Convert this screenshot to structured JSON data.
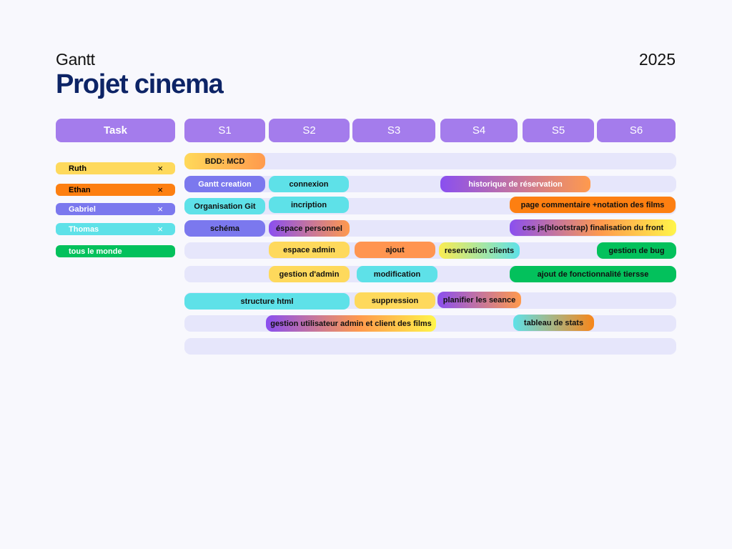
{
  "header": {
    "subtitle": "Gantt",
    "title": "Projet cinema",
    "year": "2025"
  },
  "columns": {
    "task": "Task",
    "weeks": [
      "S1",
      "S2",
      "S3",
      "S4",
      "S5",
      "S6"
    ]
  },
  "legend": [
    {
      "name": "Ruth",
      "close": "×",
      "color": "#fed95c"
    },
    {
      "name": "Ethan",
      "close": "×",
      "color": "#fd7f11"
    },
    {
      "name": "Gabriel",
      "close": "×",
      "color": "#7b78ee"
    },
    {
      "name": "Thomas",
      "close": "×",
      "color": "#5ee1e8"
    },
    {
      "name": "tous le monde",
      "color": "#03c15c"
    }
  ],
  "tasks": {
    "bdd_mcd": "BDD: MCD",
    "gantt_creation": "Gantt creation",
    "connexion": "connexion",
    "historique": "historique de réservation",
    "organisation_git": "Organisation Git",
    "incription": "incription",
    "page_commentaire": "page commentaire +notation des films",
    "schema": "schéma",
    "espace_perso": "éspace personnel",
    "css_js": "css js(blootstrap) finalisation du front",
    "espace_admin": "espace admin",
    "ajout": "ajout",
    "reservation_clients": "reservation clients",
    "gestion_bug": "gestion de bug",
    "gestion_admin": "gestion d'admin",
    "modification": "modification",
    "ajout_fonctionnalite": "ajout de fonctionnalité tiersse",
    "structure_html": "structure html",
    "suppression": "suppression",
    "planifier": "planifier les seance",
    "gestion_utilisateur": "gestion utilisateur admin et client des films",
    "tableau_stats": "tableau de stats"
  }
}
